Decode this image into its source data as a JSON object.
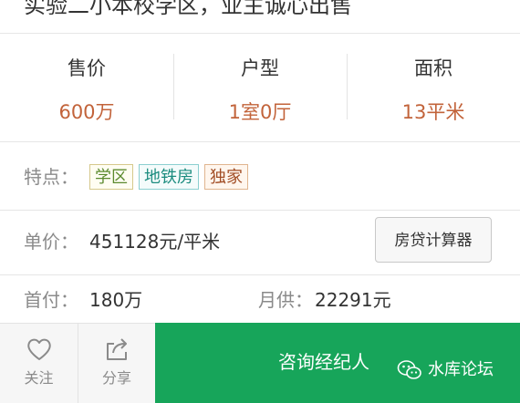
{
  "listing": {
    "title": "实验二小本校学区，业主诚心出售"
  },
  "specs": [
    {
      "label": "售价",
      "value": "600万"
    },
    {
      "label": "户型",
      "value": "1室0厅"
    },
    {
      "label": "面积",
      "value": "13平米"
    }
  ],
  "features": {
    "label": "特点：",
    "tags": [
      "学区",
      "地铁房",
      "独家"
    ]
  },
  "price": {
    "label": "单价：",
    "value": "451128元/平米",
    "calculator_label": "房贷计算器"
  },
  "payment": {
    "down_label": "首付：",
    "down_value": "180万",
    "monthly_label": "月供：",
    "monthly_value": "22291元"
  },
  "bottom_bar": {
    "follow_label": "关注",
    "share_label": "分享",
    "contact_label": "咨询经纪人",
    "watermark": "水库论坛"
  },
  "colors": {
    "accent": "#17a55a",
    "spec_value": "#c2633a"
  }
}
